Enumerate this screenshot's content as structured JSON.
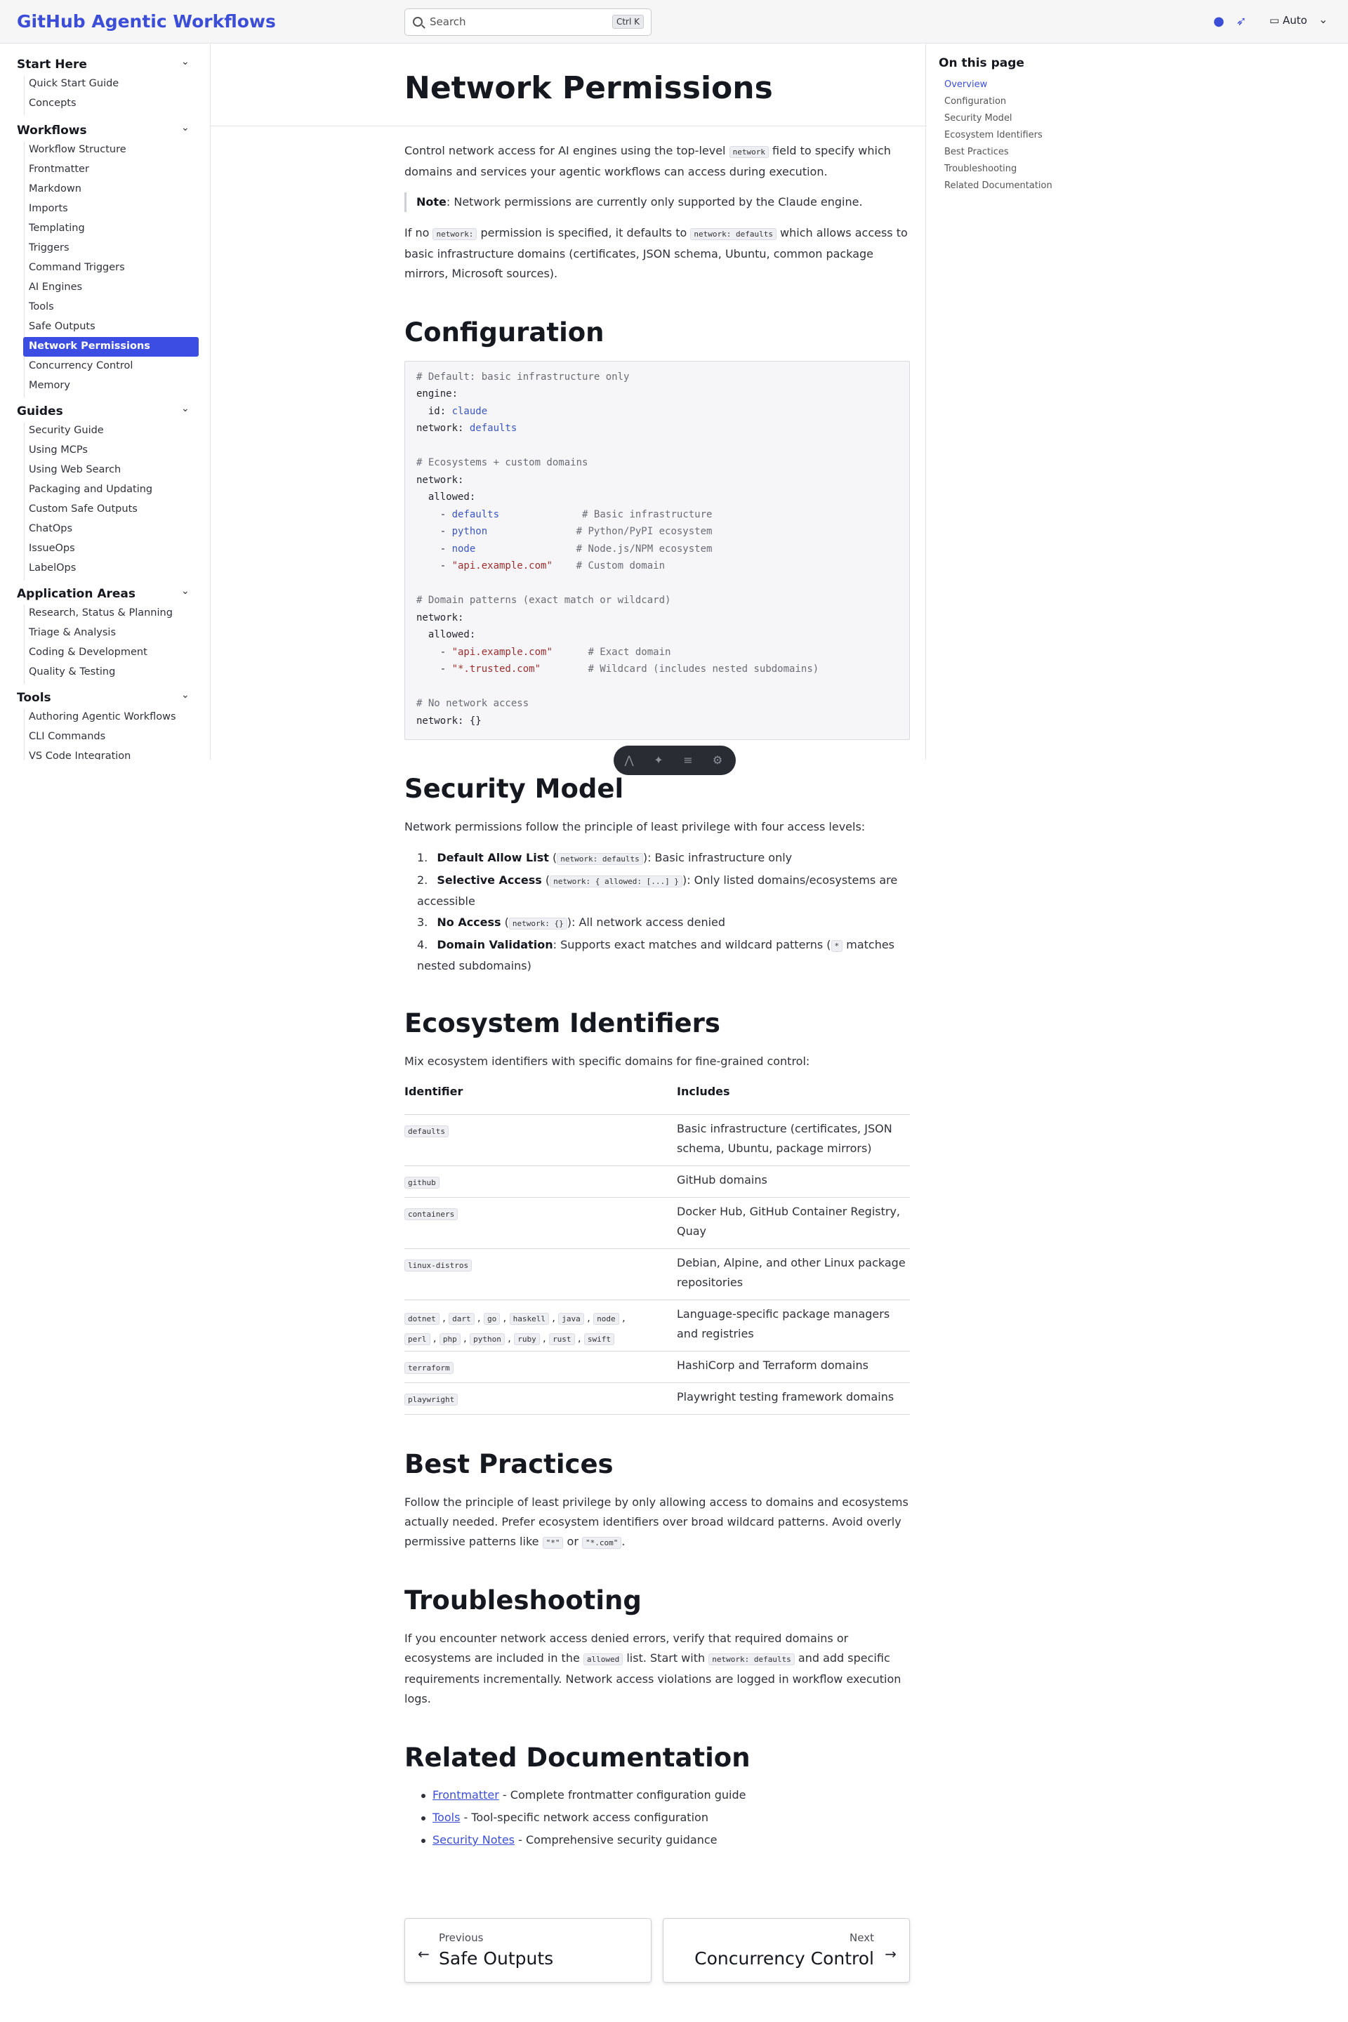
{
  "header": {
    "brand": "GitHub Agentic Workflows",
    "search_placeholder": "Search",
    "search_shortcut": "Ctrl K",
    "theme": "Auto"
  },
  "sidebar": {
    "groups": [
      {
        "title": "Start Here",
        "items": [
          "Quick Start Guide",
          "Concepts"
        ]
      },
      {
        "title": "Workflows",
        "items": [
          "Workflow Structure",
          "Frontmatter",
          "Markdown",
          "Imports",
          "Templating",
          "Triggers",
          "Command Triggers",
          "AI Engines",
          "Tools",
          "Safe Outputs",
          "Network Permissions",
          "Concurrency Control",
          "Memory"
        ]
      },
      {
        "title": "Guides",
        "items": [
          "Security Guide",
          "Using MCPs",
          "Using Web Search",
          "Packaging and Updating",
          "Custom Safe Outputs",
          "ChatOps",
          "IssueOps",
          "LabelOps"
        ]
      },
      {
        "title": "Application Areas",
        "items": [
          "Research, Status & Planning",
          "Triage & Analysis",
          "Coding & Development",
          "Quality & Testing"
        ]
      },
      {
        "title": "Tools",
        "items": [
          "Authoring Agentic Workflows",
          "CLI Commands",
          "VS Code Integration"
        ]
      }
    ],
    "active": "Network Permissions"
  },
  "toc": {
    "title": "On this page",
    "items": [
      "Overview",
      "Configuration",
      "Security Model",
      "Ecosystem Identifiers",
      "Best Practices",
      "Troubleshooting",
      "Related Documentation"
    ]
  },
  "page": {
    "title": "Network Permissions",
    "intro_pre": "Control network access for AI engines using the top-level ",
    "intro_code": "network",
    "intro_post": " field to specify which domains and services your agentic workflows can access during execution.",
    "note_label": "Note",
    "note_text": ": Network permissions are currently only supported by the Claude engine.",
    "default_pre": "If no ",
    "default_code1": "network:",
    "default_mid": " permission is specified, it defaults to ",
    "default_code2": "network: defaults",
    "default_post": " which allows access to basic infrastructure domains (certificates, JSON schema, Ubuntu, common package mirrors, Microsoft sources).",
    "h_config": "Configuration",
    "h_security": "Security Model",
    "h_ecosystem": "Ecosystem Identifiers",
    "h_best": "Best Practices",
    "h_trouble": "Troubleshooting",
    "h_related": "Related Documentation"
  },
  "code_lines": [
    "# Default: basic infrastructure only",
    "engine:",
    "  id: claude",
    "network: defaults",
    "",
    "# Ecosystems + custom domains",
    "network:",
    "  allowed:",
    "    - defaults              # Basic infrastructure",
    "    - python               # Python/PyPI ecosystem",
    "    - node                 # Node.js/NPM ecosystem",
    "    - \"api.example.com\"    # Custom domain",
    "",
    "# Domain patterns (exact match or wildcard)",
    "network:",
    "  allowed:",
    "    - \"api.example.com\"      # Exact domain",
    "    - \"*.trusted.com\"        # Wildcard (includes nested subdomains)",
    "",
    "# No network access",
    "network: {}"
  ],
  "security": {
    "intro": "Network permissions follow the principle of least privilege with four access levels:",
    "items": [
      {
        "n": "1.",
        "label": "Default Allow List",
        "code": "network: defaults",
        "text": ": Basic infrastructure only"
      },
      {
        "n": "2.",
        "label": "Selective Access",
        "code": "network: { allowed: [...] }",
        "text": ": Only listed domains/ecosystems are accessible"
      },
      {
        "n": "3.",
        "label": "No Access",
        "code": "network: {}",
        "text": ": All network access denied"
      },
      {
        "n": "4.",
        "label": "Domain Validation",
        "code": "*",
        "text_pre": ": Supports exact matches and wildcard patterns (",
        "text": " matches nested subdomains)"
      }
    ]
  },
  "ecosystem": {
    "intro": "Mix ecosystem identifiers with specific domains for fine-grained control:",
    "col1": "Identifier",
    "col2": "Includes",
    "rows": [
      {
        "ids": [
          "defaults"
        ],
        "desc": "Basic infrastructure (certificates, JSON schema, Ubuntu, package mirrors)"
      },
      {
        "ids": [
          "github"
        ],
        "desc": "GitHub domains"
      },
      {
        "ids": [
          "containers"
        ],
        "desc": "Docker Hub, GitHub Container Registry, Quay"
      },
      {
        "ids": [
          "linux-distros"
        ],
        "desc": "Debian, Alpine, and other Linux package repositories"
      },
      {
        "ids": [
          "dotnet",
          "dart",
          "go",
          "haskell",
          "java",
          "node",
          "perl",
          "php",
          "python",
          "ruby",
          "rust",
          "swift"
        ],
        "desc": "Language-specific package managers and registries"
      },
      {
        "ids": [
          "terraform"
        ],
        "desc": "HashiCorp and Terraform domains"
      },
      {
        "ids": [
          "playwright"
        ],
        "desc": "Playwright testing framework domains"
      }
    ]
  },
  "best": {
    "pre": "Follow the principle of least privilege by only allowing access to domains and ecosystems actually needed. Prefer ecosystem identifiers over broad wildcard patterns. Avoid overly permissive patterns like ",
    "code1": "\"*\"",
    "mid": " or ",
    "code2": "\"*.com\"",
    "post": "."
  },
  "trouble": {
    "pre": "If you encounter network access denied errors, verify that required domains or ecosystems are included in the ",
    "code1": "allowed",
    "mid": " list. Start with ",
    "code2": "network: defaults",
    "post": " and add specific requirements incrementally. Network access violations are logged in workflow execution logs."
  },
  "related": [
    {
      "link": "Frontmatter",
      "text": " - Complete frontmatter configuration guide"
    },
    {
      "link": "Tools",
      "text": " - Tool-specific network access configuration"
    },
    {
      "link": "Security Notes",
      "text": " - Comprehensive security guidance"
    }
  ],
  "pagination": {
    "prev_label": "Previous",
    "prev_title": "Safe Outputs",
    "next_label": "Next",
    "next_title": "Concurrency Control"
  }
}
